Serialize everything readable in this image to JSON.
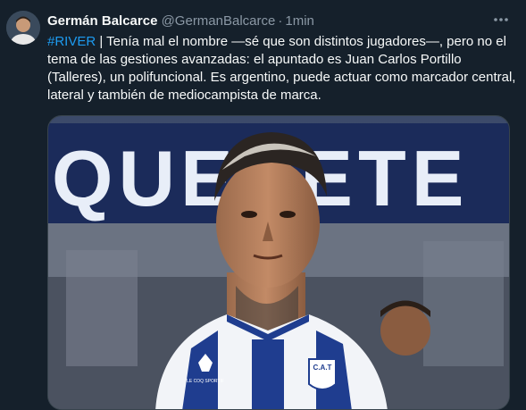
{
  "tweet": {
    "author_name": "Germán Balcarce",
    "author_handle": "@GermanBalcarce",
    "separator": "·",
    "time": "1min",
    "hashtag": "#RIVER",
    "body": " | Tenía mal el nombre —sé que son distintos jugadores—, pero no el tema de las gestiones avanzadas: el apuntado es Juan Carlos Portillo (Talleres), un polifuncional. Es argentino, puede actuar como marcador central, lateral y también de mediocampista de marca."
  },
  "media": {
    "banner_text": "QUERETE",
    "shirt_crest_text": "C.A.T",
    "shirt_brand_text": "LE COQ SPORTIF"
  },
  "icons": {
    "more": "more-horizontal-icon",
    "avatar": "avatar"
  },
  "colors": {
    "background": "#15202b",
    "text": "#f7f9f9",
    "secondary_text": "#8b98a5",
    "link": "#1d9bf0",
    "banner": "#1b2b5a",
    "shirt_stripe": "#1f3d8f"
  }
}
